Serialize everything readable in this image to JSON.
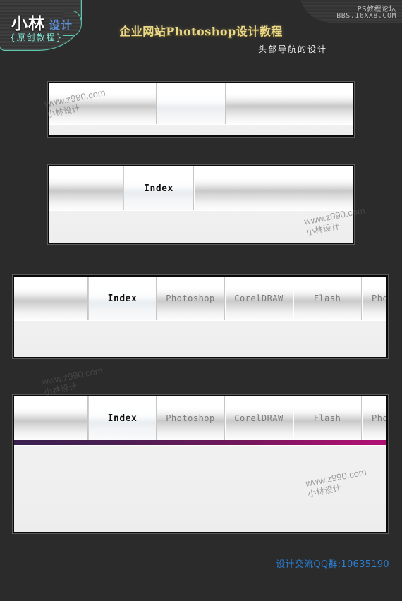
{
  "header": {
    "logo": {
      "main": "小林",
      "sub": "设计",
      "tagline": "{原创教程}"
    },
    "forum": {
      "line1": "PS教程论坛",
      "line2": "BBS.16XX8.COM"
    },
    "title": "企业网站Photoshop设计教程",
    "subtitle": "头部导航的设计"
  },
  "nav_items": [
    "Index",
    "Photoshop",
    "CorelDRAW",
    "Flash",
    "Pho"
  ],
  "panels": [
    {
      "id": "panel1",
      "label": "nav-bar-step-1-plain-gradient",
      "active_label": "",
      "has_accent": false
    },
    {
      "id": "panel2",
      "label": "nav-bar-step-2-index-cell",
      "active_label": "Index",
      "has_accent": false
    },
    {
      "id": "panel3",
      "label": "nav-bar-step-3-all-items",
      "active_label": "Index",
      "has_accent": false
    },
    {
      "id": "panel4",
      "label": "nav-bar-step-4-accent-bar",
      "active_label": "Index",
      "has_accent": true
    }
  ],
  "watermark": {
    "url": "www.z990.com",
    "cn": "小林设计"
  },
  "footer": {
    "qq": "设计交流QQ群:10635190"
  },
  "colors": {
    "background": "#2b2b2b",
    "title_gold": "#ead98a",
    "logo_blue": "#5b8fd4",
    "logo_cyan": "#7fe6d4",
    "accent_left": "#3a2050",
    "accent_right": "#b01073",
    "footer_blue": "#2a7fd4"
  }
}
